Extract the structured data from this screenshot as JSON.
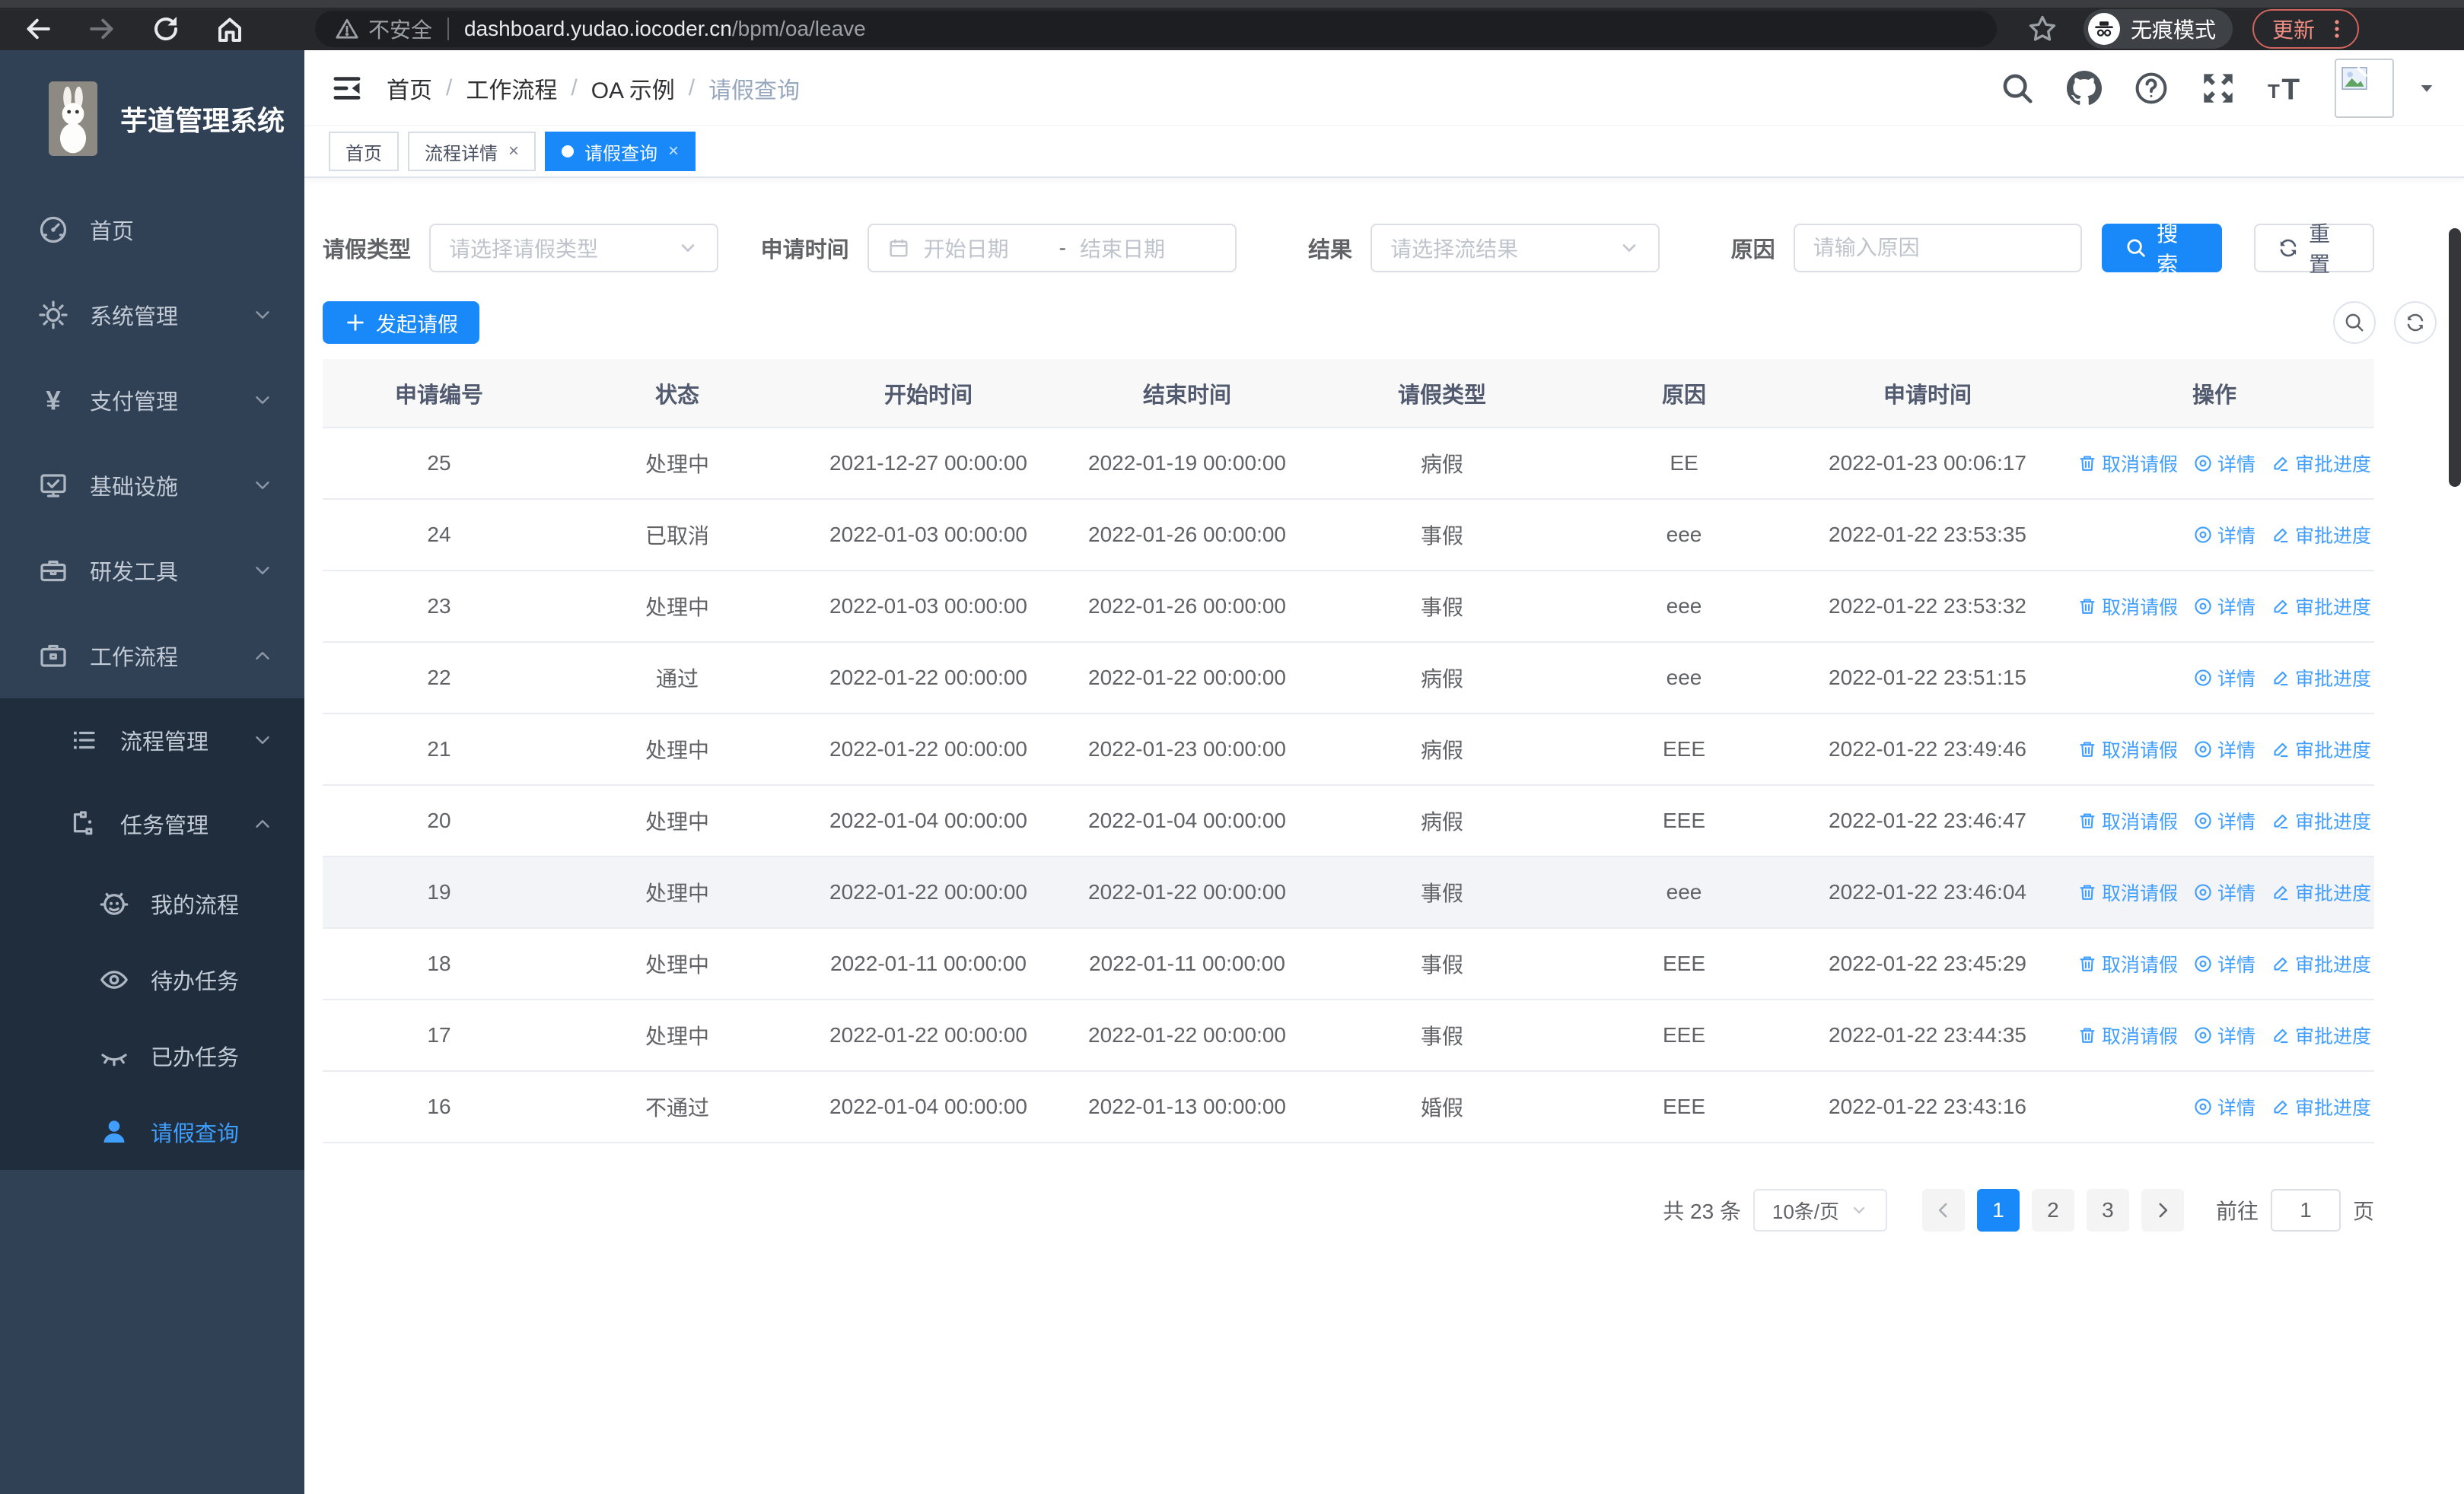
{
  "colors": {
    "primary": "#1989fa",
    "link": "#409eff",
    "sidebar_bg": "#304156",
    "submenu_bg": "#1f2d3d",
    "update_accent": "#f08e84"
  },
  "browser": {
    "security_label": "不安全",
    "url_host": "dashboard.yudao.iocoder.cn",
    "url_path": "/bpm/oa/leave",
    "incognito_label": "无痕模式",
    "update_label": "更新"
  },
  "sidebar": {
    "title": "芋道管理系统",
    "items": [
      {
        "label": "首页",
        "icon": "dashboard-icon",
        "level": 1
      },
      {
        "label": "系统管理",
        "icon": "gear-icon",
        "level": 1,
        "arrow": "down"
      },
      {
        "label": "支付管理",
        "icon": "yen-icon",
        "level": 1,
        "arrow": "down"
      },
      {
        "label": "基础设施",
        "icon": "monitor-icon",
        "level": 1,
        "arrow": "down"
      },
      {
        "label": "研发工具",
        "icon": "toolbox-icon",
        "level": 1,
        "arrow": "down"
      },
      {
        "label": "工作流程",
        "icon": "briefcase-icon",
        "level": 1,
        "arrow": "up"
      },
      {
        "label": "流程管理",
        "icon": "list-icon",
        "level": 2,
        "sub": true,
        "arrow": "down"
      },
      {
        "label": "任务管理",
        "icon": "tree-icon",
        "level": 2,
        "sub": true,
        "arrow": "up"
      },
      {
        "label": "我的流程",
        "icon": "robot-icon",
        "level": 3,
        "sub": true
      },
      {
        "label": "待办任务",
        "icon": "eye-icon",
        "level": 3,
        "sub": true
      },
      {
        "label": "已办任务",
        "icon": "eye-closed-icon",
        "level": 3,
        "sub": true
      },
      {
        "label": "请假查询",
        "icon": "user-icon",
        "level": 3,
        "sub": true,
        "active": true
      }
    ]
  },
  "header": {
    "breadcrumb": [
      "首页",
      "工作流程",
      "OA 示例",
      "请假查询"
    ]
  },
  "tabs": [
    {
      "label": "首页",
      "active": false,
      "closable": false,
      "dot": false
    },
    {
      "label": "流程详情",
      "active": false,
      "closable": true,
      "dot": false
    },
    {
      "label": "请假查询",
      "active": true,
      "closable": true,
      "dot": true
    }
  ],
  "filters": {
    "leave_type_label": "请假类型",
    "leave_type_placeholder": "请选择请假类型",
    "apply_time_label": "申请时间",
    "start_date_placeholder": "开始日期",
    "range_separator": "-",
    "end_date_placeholder": "结束日期",
    "result_label": "结果",
    "result_placeholder": "请选择流结果",
    "reason_label": "原因",
    "reason_placeholder": "请输入原因",
    "search_label": "搜索",
    "reset_label": "重置"
  },
  "toolbar": {
    "create_label": "发起请假"
  },
  "table": {
    "columns": [
      "申请编号",
      "状态",
      "开始时间",
      "结束时间",
      "请假类型",
      "原因",
      "申请时间",
      "操作"
    ],
    "action_labels": {
      "cancel": "取消请假",
      "detail": "详情",
      "progress": "审批进度"
    },
    "rows": [
      {
        "id": "25",
        "status": "处理中",
        "start": "2021-12-27 00:00:00",
        "end": "2022-01-19 00:00:00",
        "type": "病假",
        "reason": "EE",
        "applied": "2022-01-23 00:06:17",
        "actions": [
          "cancel",
          "detail",
          "progress"
        ],
        "highlight": false
      },
      {
        "id": "24",
        "status": "已取消",
        "start": "2022-01-03 00:00:00",
        "end": "2022-01-26 00:00:00",
        "type": "事假",
        "reason": "eee",
        "applied": "2022-01-22 23:53:35",
        "actions": [
          "detail",
          "progress"
        ],
        "highlight": false
      },
      {
        "id": "23",
        "status": "处理中",
        "start": "2022-01-03 00:00:00",
        "end": "2022-01-26 00:00:00",
        "type": "事假",
        "reason": "eee",
        "applied": "2022-01-22 23:53:32",
        "actions": [
          "cancel",
          "detail",
          "progress"
        ],
        "highlight": false
      },
      {
        "id": "22",
        "status": "通过",
        "start": "2022-01-22 00:00:00",
        "end": "2022-01-22 00:00:00",
        "type": "病假",
        "reason": "eee",
        "applied": "2022-01-22 23:51:15",
        "actions": [
          "detail",
          "progress"
        ],
        "highlight": false
      },
      {
        "id": "21",
        "status": "处理中",
        "start": "2022-01-22 00:00:00",
        "end": "2022-01-23 00:00:00",
        "type": "病假",
        "reason": "EEE",
        "applied": "2022-01-22 23:49:46",
        "actions": [
          "cancel",
          "detail",
          "progress"
        ],
        "highlight": false
      },
      {
        "id": "20",
        "status": "处理中",
        "start": "2022-01-04 00:00:00",
        "end": "2022-01-04 00:00:00",
        "type": "病假",
        "reason": "EEE",
        "applied": "2022-01-22 23:46:47",
        "actions": [
          "cancel",
          "detail",
          "progress"
        ],
        "highlight": false
      },
      {
        "id": "19",
        "status": "处理中",
        "start": "2022-01-22 00:00:00",
        "end": "2022-01-22 00:00:00",
        "type": "事假",
        "reason": "eee",
        "applied": "2022-01-22 23:46:04",
        "actions": [
          "cancel",
          "detail",
          "progress"
        ],
        "highlight": true
      },
      {
        "id": "18",
        "status": "处理中",
        "start": "2022-01-11 00:00:00",
        "end": "2022-01-11 00:00:00",
        "type": "事假",
        "reason": "EEE",
        "applied": "2022-01-22 23:45:29",
        "actions": [
          "cancel",
          "detail",
          "progress"
        ],
        "highlight": false
      },
      {
        "id": "17",
        "status": "处理中",
        "start": "2022-01-22 00:00:00",
        "end": "2022-01-22 00:00:00",
        "type": "事假",
        "reason": "EEE",
        "applied": "2022-01-22 23:44:35",
        "actions": [
          "cancel",
          "detail",
          "progress"
        ],
        "highlight": false
      },
      {
        "id": "16",
        "status": "不通过",
        "start": "2022-01-04 00:00:00",
        "end": "2022-01-13 00:00:00",
        "type": "婚假",
        "reason": "EEE",
        "applied": "2022-01-22 23:43:16",
        "actions": [
          "detail",
          "progress"
        ],
        "highlight": false
      }
    ]
  },
  "pagination": {
    "total_label": "共 23 条",
    "page_size": "10条/页",
    "pages": [
      "1",
      "2",
      "3"
    ],
    "active_page": "1",
    "goto_label": "前往",
    "goto_value": "1",
    "page_unit": "页"
  }
}
